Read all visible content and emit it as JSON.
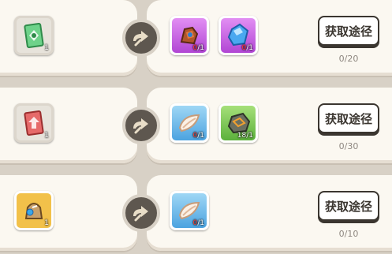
{
  "rows": [
    {
      "source": {
        "icon": "green-card-icon",
        "count": "1"
      },
      "materials": [
        {
          "icon": "bronze-gear-icon",
          "rarity": "purple",
          "owned": "0",
          "need": "/1"
        },
        {
          "icon": "blue-crystal-icon",
          "rarity": "purple",
          "owned": "0",
          "need": "/1"
        }
      ],
      "button": "获取途径",
      "progress": "0/20"
    },
    {
      "source": {
        "icon": "red-card-icon",
        "count": "1"
      },
      "materials": [
        {
          "icon": "white-feather-icon",
          "rarity": "blue",
          "owned": "0",
          "need": "/1"
        },
        {
          "icon": "ore-stone-icon",
          "rarity": "green",
          "owned": "18",
          "need": "/1"
        }
      ],
      "button": "获取途径",
      "progress": "0/30"
    },
    {
      "source": {
        "icon": "golden-relic-icon",
        "count": "1"
      },
      "materials": [
        {
          "icon": "white-feather-icon",
          "rarity": "blue",
          "owned": "0",
          "need": "/1"
        }
      ],
      "button": "获取途径",
      "progress": "0/10"
    }
  ],
  "colors": {
    "background": "#d8d1c6",
    "panel": "#fbf8f1",
    "knob": "#5e574f",
    "deficit": "#ff3b30"
  }
}
